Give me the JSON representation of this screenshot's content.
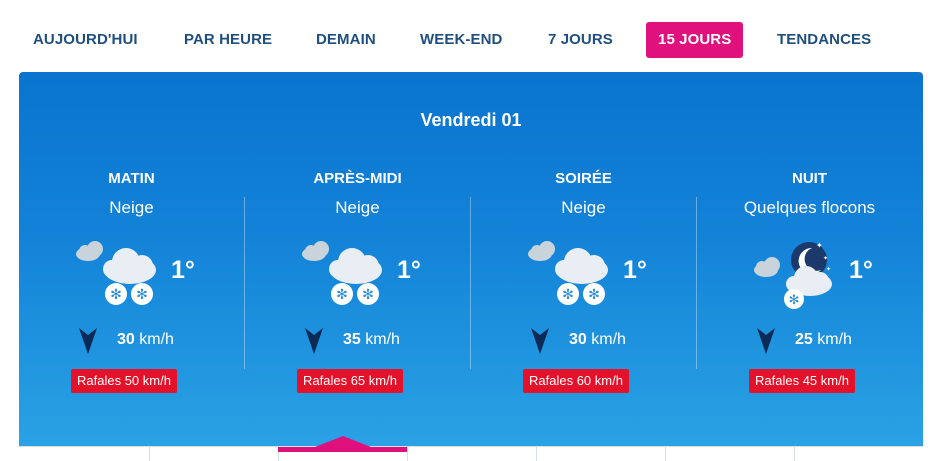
{
  "tabs": [
    {
      "label": "AUJOURD'HUI"
    },
    {
      "label": "PAR HEURE"
    },
    {
      "label": "DEMAIN"
    },
    {
      "label": "WEEK-END"
    },
    {
      "label": "7 JOURS"
    },
    {
      "label": "15 JOURS",
      "active": true
    },
    {
      "label": "TENDANCES"
    }
  ],
  "day": {
    "title": "Vendredi 01"
  },
  "periods": [
    {
      "name": "MATIN",
      "condition": "Neige",
      "icon": "snow-cloud-icon",
      "temp": "1°",
      "wind_speed": "30",
      "wind_unit": "km/h",
      "gust": "Rafales 50 km/h"
    },
    {
      "name": "APRÈS-MIDI",
      "condition": "Neige",
      "icon": "snow-cloud-icon",
      "temp": "1°",
      "wind_speed": "35",
      "wind_unit": "km/h",
      "gust": "Rafales 65 km/h"
    },
    {
      "name": "SOIRÉE",
      "condition": "Neige",
      "icon": "snow-cloud-icon",
      "temp": "1°",
      "wind_speed": "30",
      "wind_unit": "km/h",
      "gust": "Rafales 60 km/h"
    },
    {
      "name": "NUIT",
      "condition": "Quelques flocons",
      "icon": "night-snow-icon",
      "temp": "1°",
      "wind_speed": "25",
      "wind_unit": "km/h",
      "gust": "Rafales 45 km/h"
    }
  ],
  "colors": {
    "accent": "#e0107c",
    "panel_top": "#0a74cf",
    "panel_bottom": "#2aa2e4",
    "gust": "#e3122a",
    "tab_text": "#1f4f7e"
  }
}
